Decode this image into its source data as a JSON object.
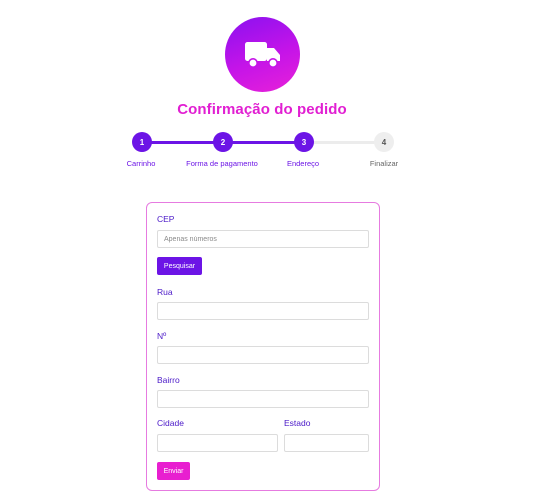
{
  "header": {
    "logo_icon": "truck-icon",
    "title": "Confirmação do pedido"
  },
  "stepper": {
    "active_color": "#6c14e6",
    "inactive_color": "#eeeeee",
    "steps": [
      {
        "number": "1",
        "label": "Carrinho",
        "state": "completed"
      },
      {
        "number": "2",
        "label": "Forma de pagamento",
        "state": "completed"
      },
      {
        "number": "3",
        "label": "Endereço",
        "state": "current"
      },
      {
        "number": "4",
        "label": "Finalizar",
        "state": "pending"
      }
    ]
  },
  "form": {
    "cep": {
      "label": "CEP",
      "placeholder": "Apenas números",
      "value": ""
    },
    "search_button": "Pesquisar",
    "rua": {
      "label": "Rua",
      "value": ""
    },
    "numero": {
      "label": "Nº",
      "value": ""
    },
    "bairro": {
      "label": "Bairro",
      "value": ""
    },
    "cidade": {
      "label": "Cidade",
      "value": ""
    },
    "estado": {
      "label": "Estado",
      "value": ""
    },
    "submit_button": "Enviar"
  },
  "colors": {
    "brand_purple": "#6c14e6",
    "brand_pink": "#e11fd2",
    "card_border": "#e67be0"
  }
}
